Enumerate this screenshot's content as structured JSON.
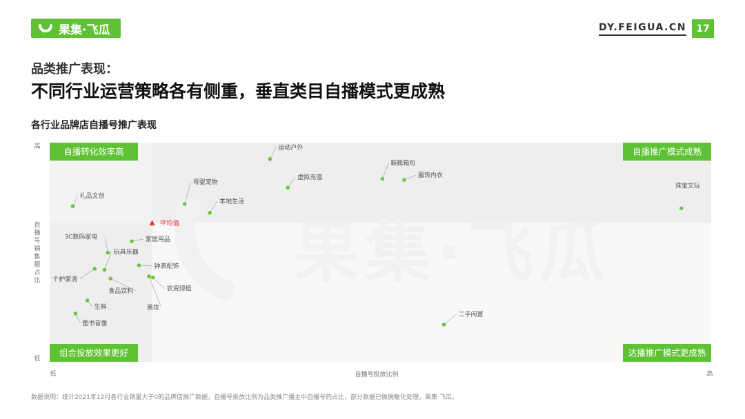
{
  "header": {
    "brand": "果集·飞瓜",
    "url": "DY.FEIGUA.CN",
    "page_number": "17",
    "accent_color": "#5ec234"
  },
  "subtitle": "品类推广表现：",
  "title": "不同行业运营策略各有侧重，垂直类目自播模式更成熟",
  "chart_title": "各行业品牌店自播号推广表现",
  "footnote": "数据说明：统计2021年12月各行业销量大于0的品牌店推广数据，自播号投放比例为品类推广播主中自播号的占比，部分数据已做脱敏化处理，果集·飞瓜。",
  "watermark": "果集·飞瓜",
  "chart_data": {
    "type": "scatter",
    "title": "各行业品牌店自播号推广表现",
    "xlabel": "自播号投放比例",
    "ylabel": "自播号销售额占比",
    "x_low_label": "低",
    "x_high_label": "高",
    "y_high_label": "高",
    "y_low_label": "低",
    "xlim": [
      0,
      100
    ],
    "ylim": [
      0,
      100
    ],
    "quadrants": {
      "top_left": "自播转化效率高",
      "top_right": "自播推广模式成熟",
      "bottom_left": "组合投放效果更好",
      "bottom_right": "达播推广模式更成熟"
    },
    "average_label": "平均值",
    "average_point": {
      "x": 15.5,
      "y": 63.5
    },
    "point_color": "#6cc63c",
    "average_color": "#e8322f",
    "points": [
      {
        "name": "运动户外",
        "x": 33.3,
        "y": 92.5
      },
      {
        "name": "鞋靴箱包",
        "x": 50.3,
        "y": 83.5
      },
      {
        "name": "服饰内衣",
        "x": 53.6,
        "y": 83.0
      },
      {
        "name": "虚拟充值",
        "x": 36.0,
        "y": 79.5
      },
      {
        "name": "珠宝文玩",
        "x": 95.5,
        "y": 70.0
      },
      {
        "name": "母婴宠物",
        "x": 20.4,
        "y": 72.0
      },
      {
        "name": "本地生活",
        "x": 24.2,
        "y": 68.0
      },
      {
        "name": "礼品文创",
        "x": 3.5,
        "y": 71.0
      },
      {
        "name": "家居用品",
        "x": 12.4,
        "y": 55.0
      },
      {
        "name": "3C数码家电",
        "x": 8.8,
        "y": 49.8
      },
      {
        "name": "玩具乐器",
        "x": 8.3,
        "y": 42.0
      },
      {
        "name": "个护家清",
        "x": 6.8,
        "y": 42.5
      },
      {
        "name": "钟表配饰",
        "x": 13.5,
        "y": 44.0
      },
      {
        "name": "食品饮料",
        "x": 9.2,
        "y": 38.0
      },
      {
        "name": "美妆",
        "x": 15.0,
        "y": 39.0
      },
      {
        "name": "农资绿植",
        "x": 15.6,
        "y": 38.5
      },
      {
        "name": "生鲜",
        "x": 5.7,
        "y": 28.0
      },
      {
        "name": "图书音像",
        "x": 3.9,
        "y": 22.0
      },
      {
        "name": "二手闲置",
        "x": 59.6,
        "y": 17.0
      }
    ]
  }
}
